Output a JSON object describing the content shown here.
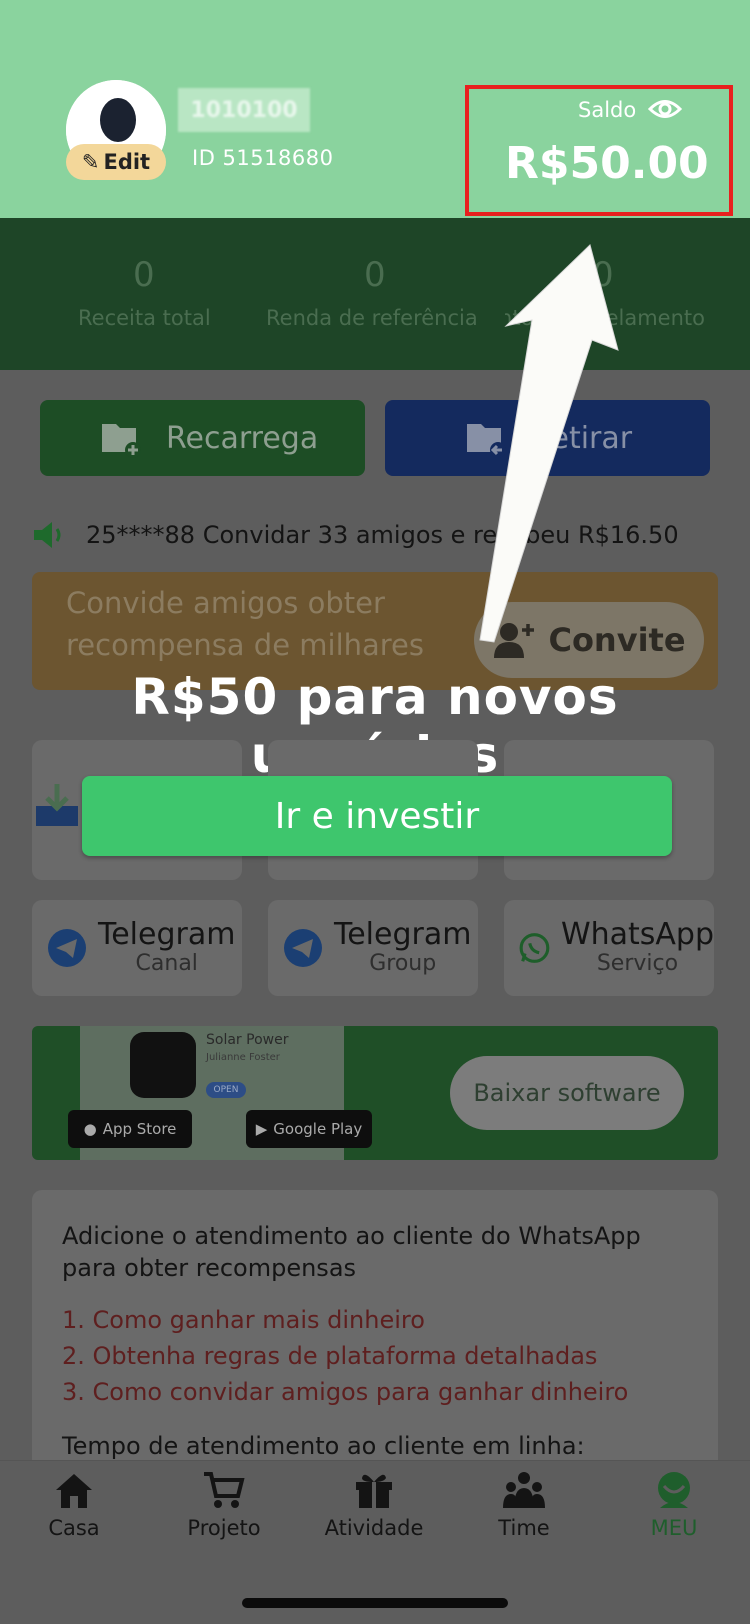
{
  "header": {
    "username": "1010100",
    "edit_label": "Edit",
    "user_id": "ID 51518680",
    "balance_label": "Saldo",
    "balance_value": "R$50.00"
  },
  "stats": [
    {
      "value": "0",
      "label": "Receita total"
    },
    {
      "value": "0",
      "label": "Renda de referência"
    },
    {
      "value": "0",
      "label": "Rendimento e parcelamento"
    }
  ],
  "actions": {
    "recharge_label": "Recarrega",
    "withdraw_label": "Retirar"
  },
  "marquee_text": "25****88 Convidar 33 amigos e recebeu R$16.50",
  "invite": {
    "text": "Convide amigos obter recompensa de milhares",
    "button_label": "Convite"
  },
  "promo": {
    "title": "R$50 para novos usuários",
    "cta_label": "Ir e investir"
  },
  "contacts": [
    {
      "title": "Telegram",
      "sub": "Canal",
      "icon": "telegram-icon"
    },
    {
      "title": "Telegram",
      "sub": "Group",
      "icon": "telegram-icon"
    },
    {
      "title": "WhatsApp",
      "sub": "Serviço",
      "icon": "whatsapp-icon"
    }
  ],
  "download": {
    "app_name": "Solar Power",
    "app_author": "Julianne Foster",
    "open_label": "OPEN",
    "app_store_label": "App Store",
    "google_play_label": "Google Play",
    "button_label": "Baixar software"
  },
  "info": {
    "heading": "Adicione o atendimento ao cliente do WhatsApp para obter recompensas",
    "items": [
      "1. Como ganhar mais dinheiro",
      "2. Obtenha regras de plataforma detalhadas",
      "3. Como convidar amigos para ganhar dinheiro"
    ],
    "time_label": "Tempo de atendimento ao cliente em linha:"
  },
  "tabs": [
    {
      "label": "Casa",
      "icon": "home-icon"
    },
    {
      "label": "Projeto",
      "icon": "cart-icon"
    },
    {
      "label": "Atividade",
      "icon": "gift-icon"
    },
    {
      "label": "Time",
      "icon": "team-icon"
    },
    {
      "label": "MEU",
      "icon": "profile-icon",
      "active": true
    }
  ],
  "colors": {
    "header_green": "#8ad39e",
    "highlight_red": "#e8201e",
    "cta_green": "#3ec66d"
  }
}
